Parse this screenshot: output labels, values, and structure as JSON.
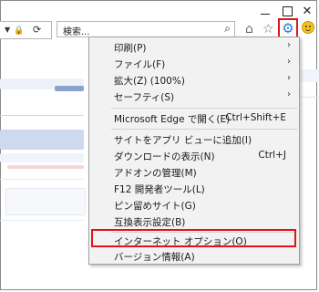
{
  "window": {
    "close_glyph": "✕"
  },
  "toolbar": {
    "search_placeholder": "検索...",
    "icons": [
      "lock-icon",
      "refresh-icon",
      "search-icon",
      "home-icon",
      "star-icon",
      "gear-icon",
      "smiley-icon"
    ],
    "accent_color": "#e0141e"
  },
  "menu": {
    "items": [
      {
        "label": "印刷(P)",
        "shortcut": "",
        "submenu": true
      },
      {
        "label": "ファイル(F)",
        "shortcut": "",
        "submenu": true
      },
      {
        "label": "拡大(Z) (100%)",
        "shortcut": "",
        "submenu": true
      },
      {
        "label": "セーフティ(S)",
        "shortcut": "",
        "submenu": true
      },
      {
        "label": "Microsoft Edge で開く(E)",
        "shortcut": "Ctrl+Shift+E",
        "submenu": false
      },
      {
        "label": "サイトをアプリ ビューに追加(I)",
        "shortcut": "",
        "submenu": false
      },
      {
        "label": "ダウンロードの表示(N)",
        "shortcut": "Ctrl+J",
        "submenu": false
      },
      {
        "label": "アドオンの管理(M)",
        "shortcut": "",
        "submenu": false
      },
      {
        "label": "F12 開発者ツール(L)",
        "shortcut": "",
        "submenu": false
      },
      {
        "label": "ピン留めサイト(G)",
        "shortcut": "",
        "submenu": false
      },
      {
        "label": "互換表示設定(B)",
        "shortcut": "",
        "submenu": false
      },
      {
        "label": "インターネット オプション(O)",
        "shortcut": "",
        "submenu": false,
        "highlighted": true
      },
      {
        "label": "バージョン情報(A)",
        "shortcut": "",
        "submenu": false
      }
    ]
  }
}
